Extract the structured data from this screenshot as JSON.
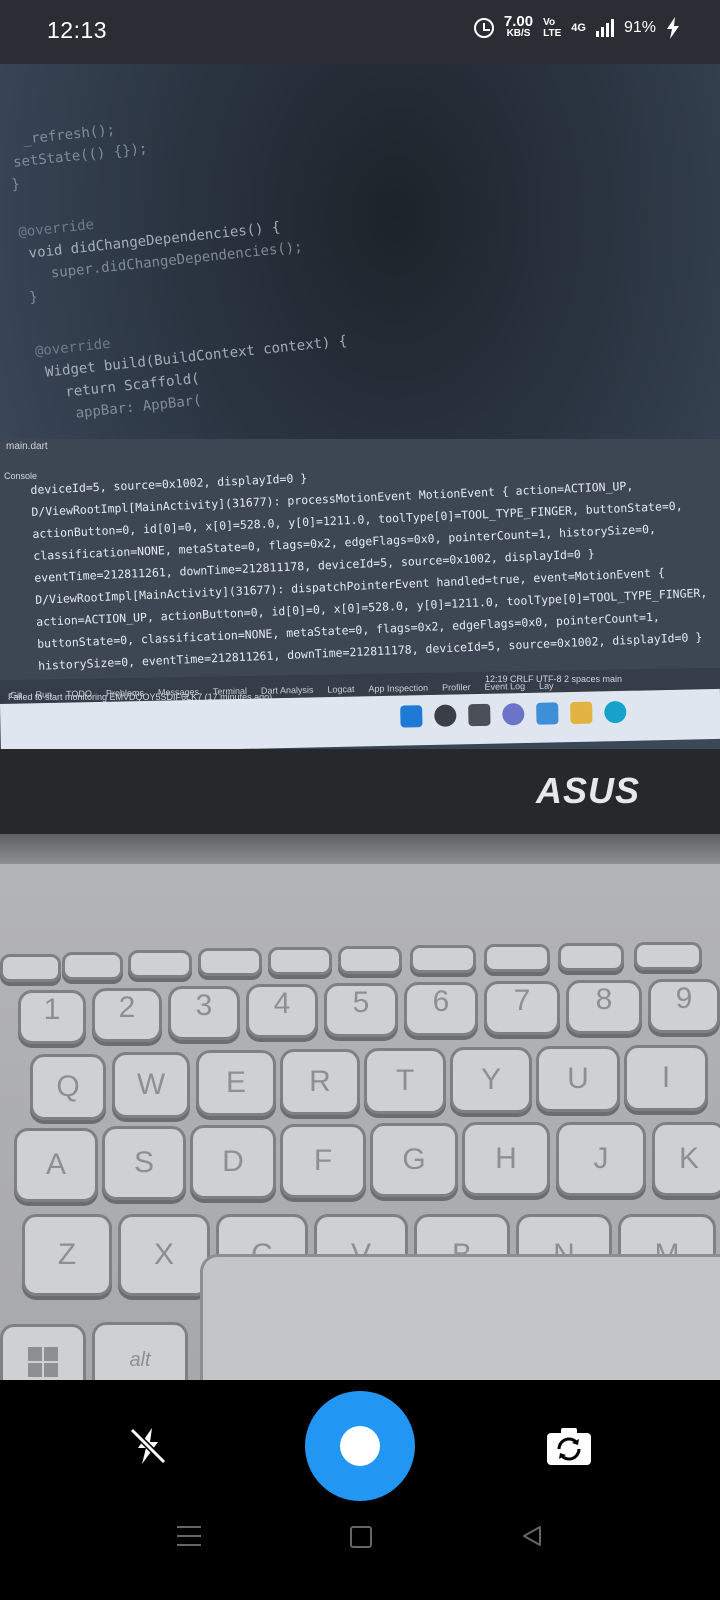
{
  "status_bar": {
    "time": "12:13",
    "net_speed_value": "7.00",
    "net_speed_unit": "KB/S",
    "volte_top": "Vo",
    "volte_bottom": "LTE",
    "network": "4G",
    "battery": "91%",
    "icons": [
      "alarm-icon",
      "signal-icon",
      "charging-icon"
    ]
  },
  "viewfinder": {
    "code_lines": [
      "_refresh();",
      "setState(() {});",
      "}",
      "@override",
      "void didChangeDependencies() {",
      "super.didChangeDependencies();",
      "}",
      "@override",
      "Widget build(BuildContext context) {",
      "return Scaffold(",
      "appBar: AppBar("
    ],
    "file_tab": "main.dart",
    "console_label": "Console",
    "log_lines": [
      "deviceId=5, source=0x1002, displayId=0 }",
      "D/ViewRootImpl[MainActivity](31677): processMotionEvent MotionEvent { action=ACTION_UP,",
      "actionButton=0, id[0]=0, x[0]=528.0, y[0]=1211.0, toolType[0]=TOOL_TYPE_FINGER, buttonState=0,",
      "classification=NONE, metaState=0, flags=0x2, edgeFlags=0x0, pointerCount=1, historySize=0,",
      "eventTime=212811261, downTime=212811178, deviceId=5, source=0x1002, displayId=0 }",
      "D/ViewRootImpl[MainActivity](31677): dispatchPointerEvent handled=true, event=MotionEvent {",
      "action=ACTION_UP, actionButton=0, id[0]=0, x[0]=528.0, y[0]=1211.0, toolType[0]=TOOL_TYPE_FINGER,",
      "buttonState=0, classification=NONE, metaState=0, flags=0x2, edgeFlags=0x0, pointerCount=1,",
      "historySize=0, eventTime=212811261, downTime=212811178, deviceId=5, source=0x1002, displayId=0 }"
    ],
    "tool_tabs": [
      "Git",
      "Run",
      "TODO",
      "Problems",
      "Messages",
      "Terminal",
      "Dart Analysis",
      "Logcat",
      "App Inspection",
      "Profiler",
      "Event Log",
      "Lay"
    ],
    "status_line": "Failed to start monitoring EMVDQOY5SDIF6LK7 (17 minutes ago)",
    "status_right": "12:19  CRLF  UTF-8  2 spaces  main",
    "laptop_brand": "ASUS",
    "number_keys": [
      "1",
      "2",
      "3",
      "4",
      "5",
      "6",
      "7",
      "8",
      "9"
    ],
    "top_row": [
      "Q",
      "W",
      "E",
      "R",
      "T",
      "Y",
      "U",
      "I"
    ],
    "home_row": [
      "A",
      "S",
      "D",
      "F",
      "G",
      "H",
      "J",
      "K"
    ],
    "bottom_row": [
      "Z",
      "X",
      "C",
      "V",
      "B",
      "N",
      "M"
    ],
    "alt_key": "alt"
  },
  "camera_controls": {
    "icons": [
      "flash-off-icon",
      "shutter-icon",
      "switch-camera-icon"
    ],
    "shutter_color": "#2196f3"
  },
  "nav_bar": {
    "icons": [
      "menu-icon",
      "home-icon",
      "back-icon"
    ]
  }
}
